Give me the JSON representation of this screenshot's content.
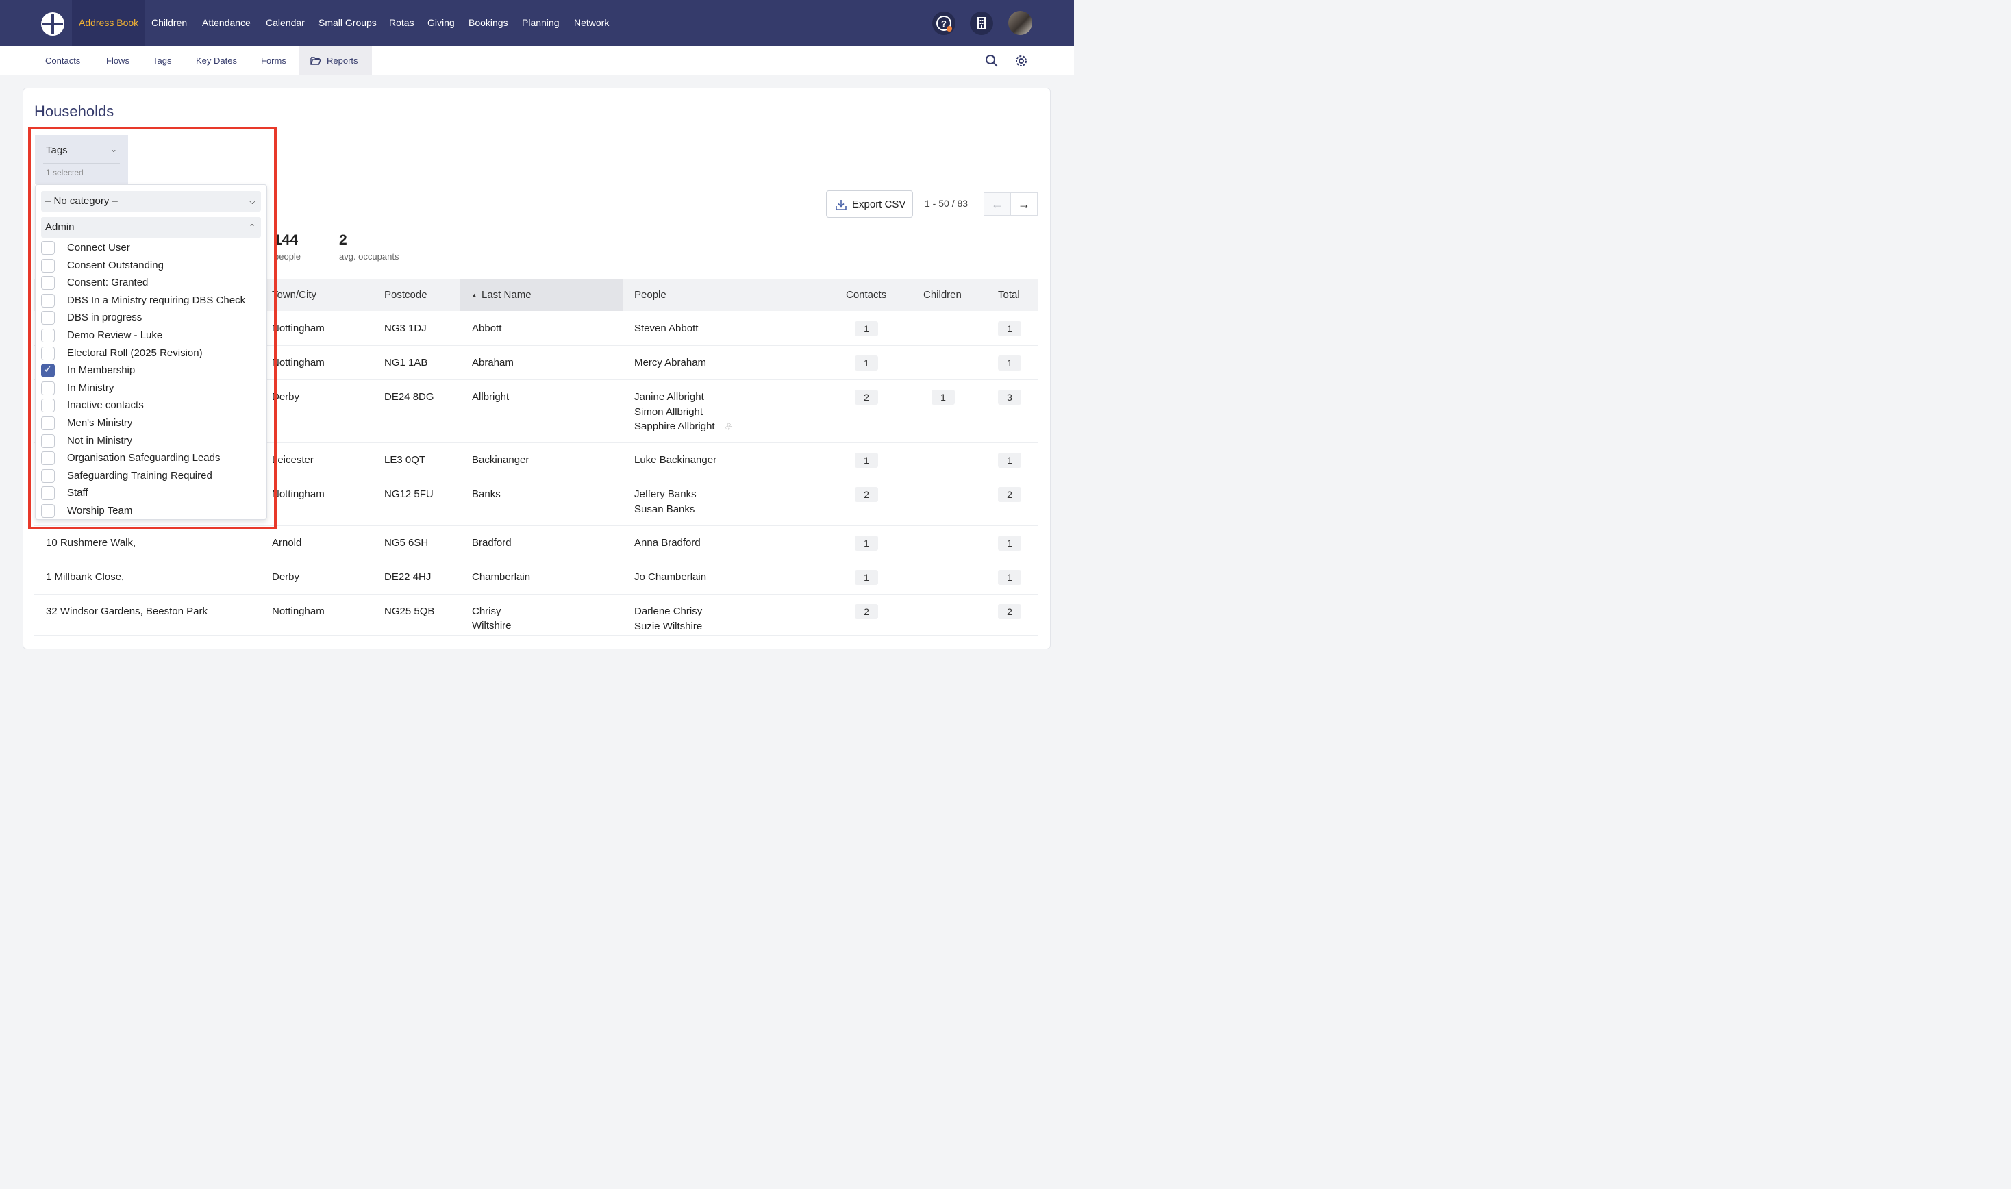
{
  "nav": {
    "items": [
      "Address Book",
      "Children",
      "Attendance",
      "Calendar",
      "Small Groups",
      "Rotas",
      "Giving",
      "Bookings",
      "Planning",
      "Network"
    ],
    "active": "Address Book",
    "accent_color": "#f2b233",
    "background_color": "#353b6b"
  },
  "subnav": {
    "items": [
      "Contacts",
      "Flows",
      "Tags",
      "Key Dates",
      "Forms",
      "Reports"
    ],
    "active": "Reports"
  },
  "page": {
    "title": "Households"
  },
  "filter": {
    "label": "Tags",
    "selected_text": "1 selected",
    "categories": [
      {
        "label": "– No category –",
        "expanded": false
      },
      {
        "label": "Admin",
        "expanded": true
      }
    ],
    "options": [
      {
        "label": "Connect User",
        "checked": false
      },
      {
        "label": "Consent Outstanding",
        "checked": false
      },
      {
        "label": "Consent: Granted",
        "checked": false
      },
      {
        "label": "DBS In a Ministry requiring DBS Check",
        "checked": false
      },
      {
        "label": "DBS in progress",
        "checked": false
      },
      {
        "label": "Demo Review - Luke",
        "checked": false
      },
      {
        "label": "Electoral Roll (2025 Revision)",
        "checked": false
      },
      {
        "label": "In Membership",
        "checked": true
      },
      {
        "label": "In Ministry",
        "checked": false
      },
      {
        "label": "Inactive contacts",
        "checked": false
      },
      {
        "label": "Men's Ministry",
        "checked": false
      },
      {
        "label": "Not in Ministry",
        "checked": false
      },
      {
        "label": "Organisation Safeguarding Leads",
        "checked": false
      },
      {
        "label": "Safeguarding Training Required",
        "checked": false
      },
      {
        "label": "Staff",
        "checked": false
      },
      {
        "label": "Worship Team",
        "checked": false
      }
    ]
  },
  "export": {
    "label": "Export CSV"
  },
  "pagination": {
    "text": "1 - 50 / 83"
  },
  "stats": [
    {
      "value": "144",
      "label": "people"
    },
    {
      "value": "2",
      "label": "avg. occupants"
    }
  ],
  "table": {
    "columns": [
      "Town/City",
      "Postcode",
      "Last Name",
      "People",
      "Contacts",
      "Children",
      "Total"
    ],
    "sorted_column": "Last Name",
    "rows": [
      {
        "address": "",
        "town": "Nottingham",
        "postcode": "NG3 1DJ",
        "last_name": "Abbott",
        "people": [
          "Steven Abbott"
        ],
        "contacts": "1",
        "children": "",
        "total": "1"
      },
      {
        "address": "",
        "town": "Nottingham",
        "postcode": "NG1 1AB",
        "last_name": "Abraham",
        "people": [
          "Mercy Abraham"
        ],
        "contacts": "1",
        "children": "",
        "total": "1"
      },
      {
        "address": "",
        "town": "Derby",
        "postcode": "DE24 8DG",
        "last_name": "Allbright",
        "people": [
          "Janine Allbright",
          "Simon Allbright",
          "Sapphire Allbright"
        ],
        "contacts": "2",
        "children": "1",
        "total": "3"
      },
      {
        "address": "",
        "town": "Leicester",
        "postcode": "LE3 0QT",
        "last_name": "Backinanger",
        "people": [
          "Luke Backinanger"
        ],
        "contacts": "1",
        "children": "",
        "total": "1"
      },
      {
        "address": "",
        "town": "Nottingham",
        "postcode": "NG12 5FU",
        "last_name": "Banks",
        "people": [
          "Jeffery Banks",
          "Susan Banks"
        ],
        "contacts": "2",
        "children": "",
        "total": "2"
      },
      {
        "address": "10 Rushmere Walk,",
        "town": "Arnold",
        "postcode": "NG5 6SH",
        "last_name": "Bradford",
        "people": [
          "Anna Bradford"
        ],
        "contacts": "1",
        "children": "",
        "total": "1"
      },
      {
        "address": "1 Millbank Close,",
        "town": "Derby",
        "postcode": "DE22 4HJ",
        "last_name": "Chamberlain",
        "people": [
          "Jo Chamberlain"
        ],
        "contacts": "1",
        "children": "",
        "total": "1"
      },
      {
        "address": "32 Windsor Gardens, Beeston Park",
        "town": "Nottingham",
        "postcode": "NG25 5QB",
        "last_name": "Chrisy Wiltshire",
        "people": [
          "Darlene Chrisy",
          "Suzie Wiltshire"
        ],
        "contacts": "2",
        "children": "",
        "total": "2"
      }
    ]
  }
}
